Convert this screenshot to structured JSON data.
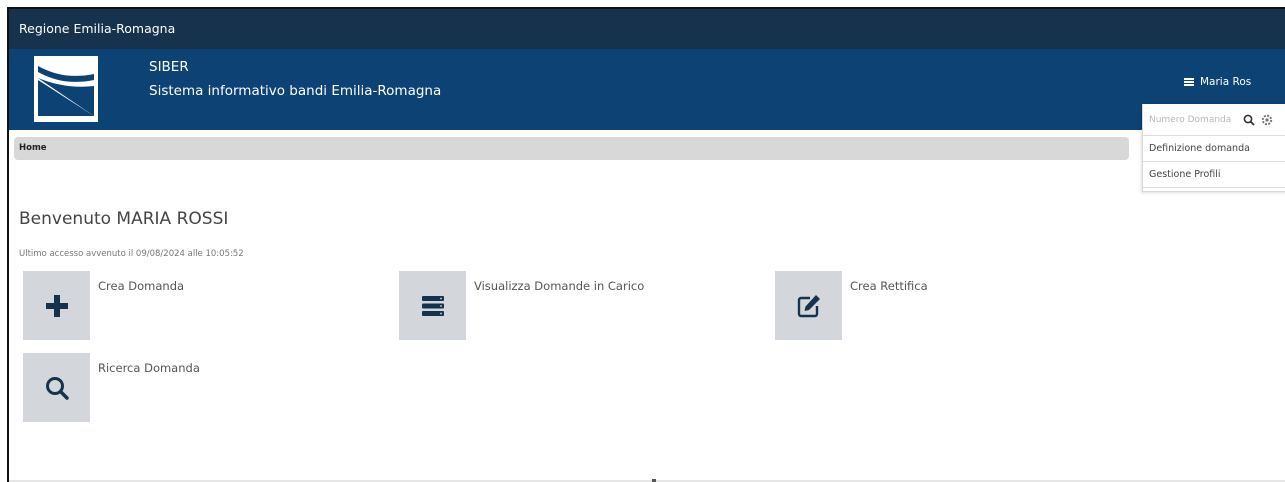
{
  "top_bar": {
    "title": "Regione Emilia-Romagna"
  },
  "header": {
    "app_name": "SIBER",
    "app_subtitle": "Sistema informativo bandi Emilia-Romagna",
    "user_name": "Maria Ros"
  },
  "user_dropdown": {
    "search_placeholder": "Numero Domanda",
    "items": [
      {
        "label": "Definizione domanda"
      },
      {
        "label": "Gestione Profili"
      }
    ]
  },
  "breadcrumb": {
    "home": "Home"
  },
  "main": {
    "welcome": "Benvenuto MARIA ROSSI",
    "last_access": "Ultimo accesso avvenuto il 09/08/2024 alle 10:05:52",
    "actions": [
      {
        "label": "Crea Domanda",
        "icon": "plus-icon"
      },
      {
        "label": "Visualizza Domande in Carico",
        "icon": "list-icon"
      },
      {
        "label": "Crea Rettifica",
        "icon": "edit-icon"
      },
      {
        "label": "Ricerca Domanda",
        "icon": "search-icon"
      }
    ]
  },
  "colors": {
    "top_bar": "#17324d",
    "header": "#0d4275",
    "tile": "#d3d7db",
    "breadcrumb": "#d8d8d8"
  }
}
